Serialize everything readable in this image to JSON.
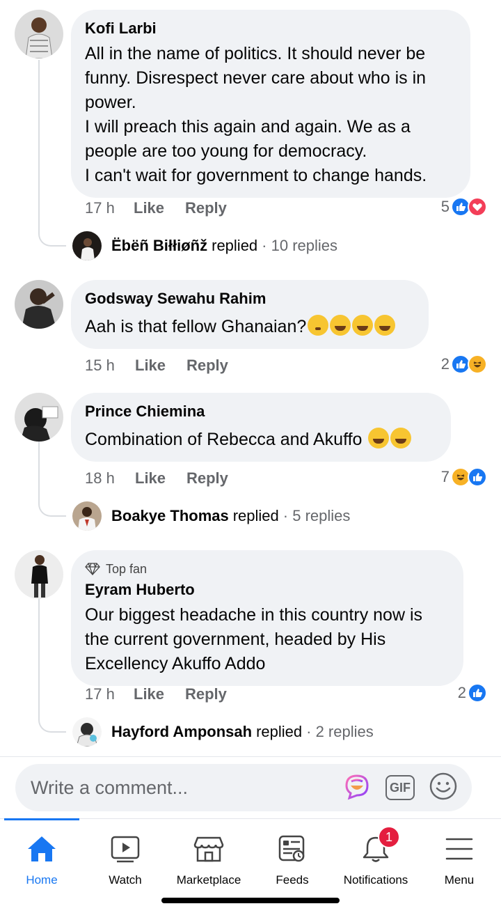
{
  "comments": [
    {
      "author": "Kofi Larbi",
      "lines": [
        "All in the name of politics. It should never be",
        "funny. Disrespect never care about who is in",
        "power.",
        "I will preach this again and again. We as a",
        "people are too young for democracy.",
        "I can't wait for government to change hands."
      ],
      "time": "17 h",
      "like_label": "Like",
      "reply_label": "Reply",
      "reaction_count": "5",
      "reactions": [
        "like",
        "love"
      ],
      "replies": {
        "name": "Ëbëñ Biłłiøñž",
        "verb": "replied",
        "count": "· 10 replies"
      }
    },
    {
      "author": "Godsway Sewahu Rahim",
      "text": "Aah is that fellow Ghanaian?",
      "time": "15 h",
      "like_label": "Like",
      "reply_label": "Reply",
      "reaction_count": "2",
      "reactions": [
        "like",
        "haha"
      ]
    },
    {
      "author": "Prince Chiemina",
      "text": "Combination of Rebecca and Akuffo",
      "time": "18 h",
      "like_label": "Like",
      "reply_label": "Reply",
      "reaction_count": "7",
      "reactions": [
        "haha",
        "like"
      ],
      "replies": {
        "name": "Boakye Thomas",
        "verb": "replied",
        "count": "· 5 replies"
      }
    },
    {
      "badge": "Top fan",
      "author": "Eyram Huberto",
      "lines": [
        "Our biggest headache in this country now is",
        "the current government, headed by His",
        "Excellency Akuffo Addo"
      ],
      "time": "17 h",
      "like_label": "Like",
      "reply_label": "Reply",
      "reaction_count": "2",
      "reactions": [
        "like"
      ],
      "replies": {
        "name": "Hayford Amponsah",
        "verb": "replied",
        "count": "· 2 replies"
      }
    }
  ],
  "composer": {
    "placeholder": "Write a comment...",
    "gif_label": "GIF"
  },
  "nav": {
    "items": [
      {
        "label": "Home",
        "icon": "home-icon",
        "active": true
      },
      {
        "label": "Watch",
        "icon": "watch-icon"
      },
      {
        "label": "Marketplace",
        "icon": "marketplace-icon"
      },
      {
        "label": "Feeds",
        "icon": "feeds-icon"
      },
      {
        "label": "Notifications",
        "icon": "bell-icon",
        "badge": "1"
      },
      {
        "label": "Menu",
        "icon": "menu-icon"
      }
    ]
  },
  "colors": {
    "accent": "#1877f2",
    "bubble": "#f0f2f5",
    "love": "#f33e58",
    "haha": "#f7b125",
    "badge": "#e41e3f"
  }
}
